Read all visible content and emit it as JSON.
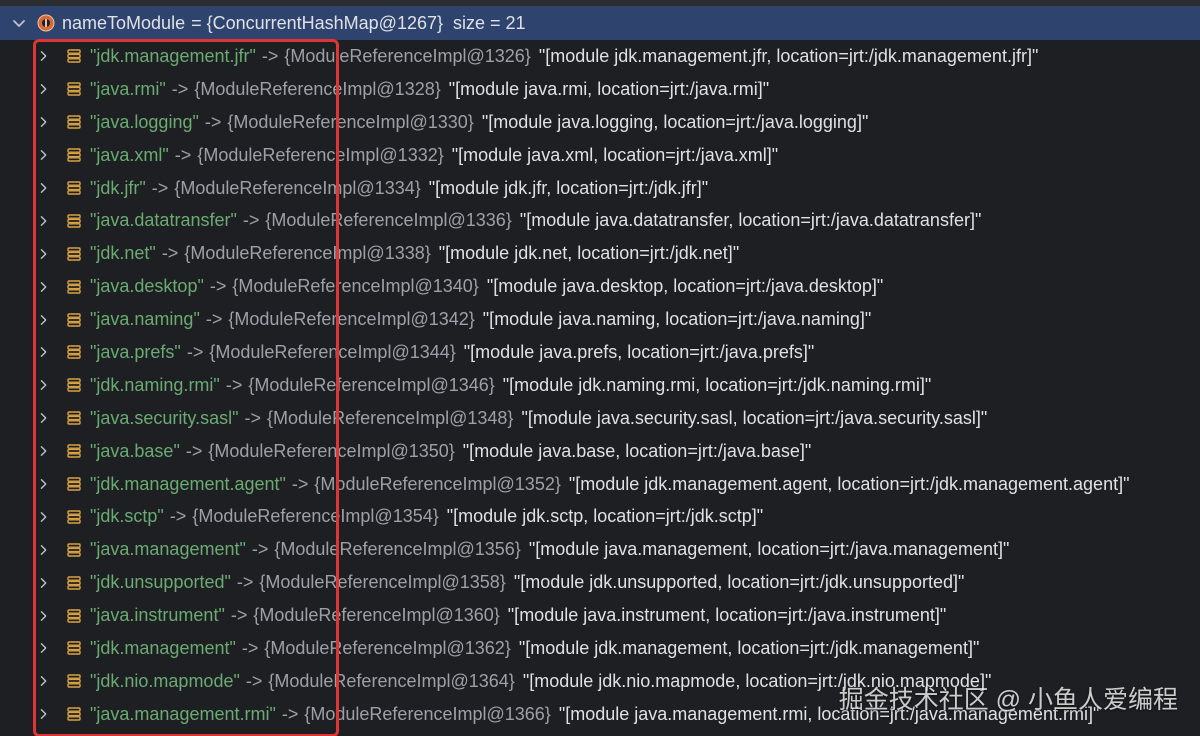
{
  "header": {
    "var_name": "nameToModule",
    "type_ref": "= {ConcurrentHashMap@1267}",
    "size_info": "size = 21"
  },
  "rows": [
    {
      "key": "\"jdk.management.jfr\"",
      "ref": "{ModuleReferenceImpl@1326}",
      "desc": "\"[module jdk.management.jfr, location=jrt:/jdk.management.jfr]\""
    },
    {
      "key": "\"java.rmi\"",
      "ref": "{ModuleReferenceImpl@1328}",
      "desc": "\"[module java.rmi, location=jrt:/java.rmi]\""
    },
    {
      "key": "\"java.logging\"",
      "ref": "{ModuleReferenceImpl@1330}",
      "desc": "\"[module java.logging, location=jrt:/java.logging]\""
    },
    {
      "key": "\"java.xml\"",
      "ref": "{ModuleReferenceImpl@1332}",
      "desc": "\"[module java.xml, location=jrt:/java.xml]\""
    },
    {
      "key": "\"jdk.jfr\"",
      "ref": "{ModuleReferenceImpl@1334}",
      "desc": "\"[module jdk.jfr, location=jrt:/jdk.jfr]\""
    },
    {
      "key": "\"java.datatransfer\"",
      "ref": "{ModuleReferenceImpl@1336}",
      "desc": "\"[module java.datatransfer, location=jrt:/java.datatransfer]\""
    },
    {
      "key": "\"jdk.net\"",
      "ref": "{ModuleReferenceImpl@1338}",
      "desc": "\"[module jdk.net, location=jrt:/jdk.net]\""
    },
    {
      "key": "\"java.desktop\"",
      "ref": "{ModuleReferenceImpl@1340}",
      "desc": "\"[module java.desktop, location=jrt:/java.desktop]\""
    },
    {
      "key": "\"java.naming\"",
      "ref": "{ModuleReferenceImpl@1342}",
      "desc": "\"[module java.naming, location=jrt:/java.naming]\""
    },
    {
      "key": "\"java.prefs\"",
      "ref": "{ModuleReferenceImpl@1344}",
      "desc": "\"[module java.prefs, location=jrt:/java.prefs]\""
    },
    {
      "key": "\"jdk.naming.rmi\"",
      "ref": "{ModuleReferenceImpl@1346}",
      "desc": "\"[module jdk.naming.rmi, location=jrt:/jdk.naming.rmi]\""
    },
    {
      "key": "\"java.security.sasl\"",
      "ref": "{ModuleReferenceImpl@1348}",
      "desc": "\"[module java.security.sasl, location=jrt:/java.security.sasl]\""
    },
    {
      "key": "\"java.base\"",
      "ref": "{ModuleReferenceImpl@1350}",
      "desc": "\"[module java.base, location=jrt:/java.base]\""
    },
    {
      "key": "\"jdk.management.agent\"",
      "ref": "{ModuleReferenceImpl@1352}",
      "desc": "\"[module jdk.management.agent, location=jrt:/jdk.management.agent]\""
    },
    {
      "key": "\"jdk.sctp\"",
      "ref": "{ModuleReferenceImpl@1354}",
      "desc": "\"[module jdk.sctp, location=jrt:/jdk.sctp]\""
    },
    {
      "key": "\"java.management\"",
      "ref": "{ModuleReferenceImpl@1356}",
      "desc": "\"[module java.management, location=jrt:/java.management]\""
    },
    {
      "key": "\"jdk.unsupported\"",
      "ref": "{ModuleReferenceImpl@1358}",
      "desc": "\"[module jdk.unsupported, location=jrt:/jdk.unsupported]\""
    },
    {
      "key": "\"java.instrument\"",
      "ref": "{ModuleReferenceImpl@1360}",
      "desc": "\"[module java.instrument, location=jrt:/java.instrument]\""
    },
    {
      "key": "\"jdk.management\"",
      "ref": "{ModuleReferenceImpl@1362}",
      "desc": "\"[module jdk.management, location=jrt:/jdk.management]\""
    },
    {
      "key": "\"jdk.nio.mapmode\"",
      "ref": "{ModuleReferenceImpl@1364}",
      "desc": "\"[module jdk.nio.mapmode, location=jrt:/jdk.nio.mapmode]\""
    },
    {
      "key": "\"java.management.rmi\"",
      "ref": "{ModuleReferenceImpl@1366}",
      "desc": "\"[module java.management.rmi, location=jrt:/java.management.rmi]\""
    }
  ],
  "arrow": "->",
  "watermark": "掘金技术社区 @ 小鱼人爱编程",
  "colors": {
    "background": "#1e1f22",
    "header_selection": "#2e436e",
    "key_string": "#6aab73",
    "secondary_text": "#9da0a8",
    "primary_text": "#dfe1e5",
    "field_icon": "#d9a343",
    "highlight_box": "#e03535"
  },
  "icons": {
    "expanded": "chevron-down-icon",
    "collapsed": "chevron-right-icon",
    "header": "object-info-icon",
    "row": "map-entry-icon"
  }
}
